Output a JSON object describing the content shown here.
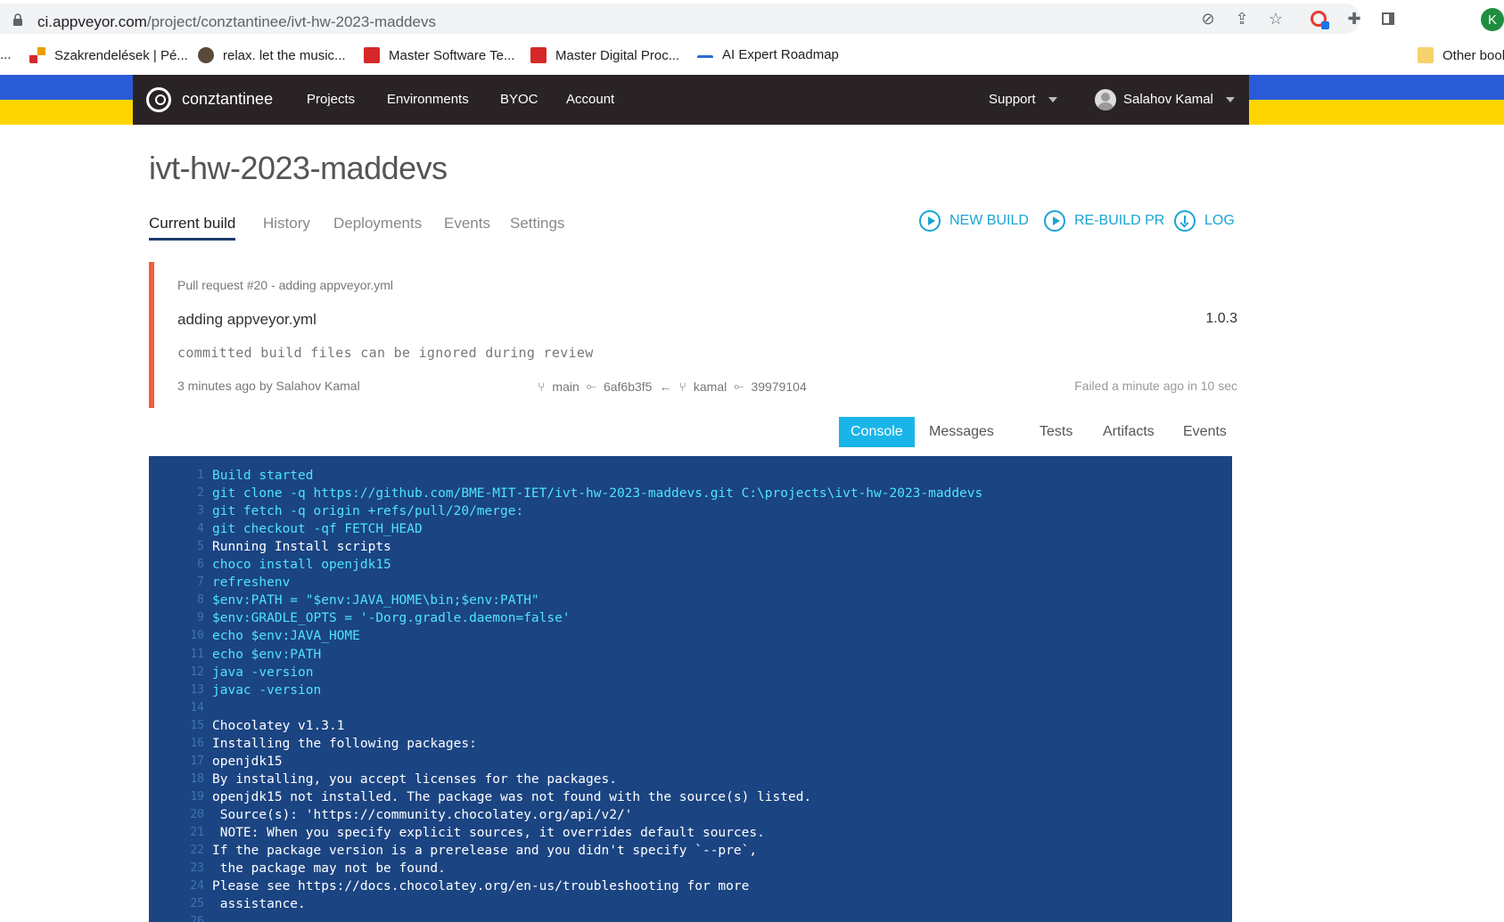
{
  "browser": {
    "url_host": "ci.appveyor.com",
    "url_path": "/project/conztantinee/ivt-hw-2023-maddevs",
    "profile_initial": "K",
    "bookmarks": [
      {
        "label": "...",
        "color": ""
      },
      {
        "label": "Szakrendelések | Pé...",
        "color": "#e8a000"
      },
      {
        "label": "relax. let the music...",
        "color": "#5a4a3a"
      },
      {
        "label": "Master Software Te...",
        "color": "#d62828"
      },
      {
        "label": "Master Digital Proc...",
        "color": "#d62828"
      },
      {
        "label": "AI Expert Roadmap",
        "color": "#2a6ad6"
      }
    ],
    "other_bookmarks": "Other book"
  },
  "nav": {
    "brand": "conztantinee",
    "links": [
      "Projects",
      "Environments",
      "BYOC",
      "Account"
    ],
    "support": "Support",
    "user": "Salahov Kamal"
  },
  "project": {
    "title": "ivt-hw-2023-maddevs",
    "tabs": [
      "Current build",
      "History",
      "Deployments",
      "Events",
      "Settings"
    ],
    "actions": [
      "NEW BUILD",
      "RE-BUILD PR",
      "LOG"
    ]
  },
  "build": {
    "pull_request": "Pull request #20 - adding appveyor.yml",
    "message": "adding appveyor.yml",
    "version": "1.0.3",
    "description": "committed build files can be ignored during review",
    "author": "3 minutes ago by Salahov Kamal",
    "base_branch": "main",
    "base_commit": "6af6b3f5",
    "head_branch": "kamal",
    "head_commit": "39979104",
    "status": "Failed a minute ago in 10 sec"
  },
  "console_tabs": [
    "Console",
    "Messages",
    "Tests",
    "Artifacts",
    "Events"
  ],
  "console": [
    {
      "n": "1",
      "text": "Build started",
      "kind": "cmd"
    },
    {
      "n": "2",
      "text": "git clone -q https://github.com/BME-MIT-IET/ivt-hw-2023-maddevs.git C:\\projects\\ivt-hw-2023-maddevs",
      "kind": "cmd"
    },
    {
      "n": "3",
      "text": "git fetch -q origin +refs/pull/20/merge:",
      "kind": "cmd"
    },
    {
      "n": "4",
      "text": "git checkout -qf FETCH_HEAD",
      "kind": "cmd"
    },
    {
      "n": "5",
      "text": "Running Install scripts",
      "kind": "out"
    },
    {
      "n": "6",
      "text": "choco install openjdk15",
      "kind": "cmd"
    },
    {
      "n": "7",
      "text": "refreshenv",
      "kind": "cmd"
    },
    {
      "n": "8",
      "text": "$env:PATH = \"$env:JAVA_HOME\\bin;$env:PATH\"",
      "kind": "cmd"
    },
    {
      "n": "9",
      "text": "$env:GRADLE_OPTS = '-Dorg.gradle.daemon=false'",
      "kind": "cmd"
    },
    {
      "n": "10",
      "text": "echo $env:JAVA_HOME",
      "kind": "cmd"
    },
    {
      "n": "11",
      "text": "echo $env:PATH",
      "kind": "cmd"
    },
    {
      "n": "12",
      "text": "java -version",
      "kind": "cmd"
    },
    {
      "n": "13",
      "text": "javac -version",
      "kind": "cmd"
    },
    {
      "n": "14",
      "text": "",
      "kind": "out"
    },
    {
      "n": "15",
      "text": "Chocolatey v1.3.1",
      "kind": "out"
    },
    {
      "n": "16",
      "text": "Installing the following packages:",
      "kind": "out"
    },
    {
      "n": "17",
      "text": "openjdk15",
      "kind": "out"
    },
    {
      "n": "18",
      "text": "By installing, you accept licenses for the packages.",
      "kind": "out"
    },
    {
      "n": "19",
      "text": "openjdk15 not installed. The package was not found with the source(s) listed.",
      "kind": "out"
    },
    {
      "n": "20",
      "text": " Source(s): 'https://community.chocolatey.org/api/v2/'",
      "kind": "out"
    },
    {
      "n": "21",
      "text": " NOTE: When you specify explicit sources, it overrides default sources.",
      "kind": "out"
    },
    {
      "n": "22",
      "text": "If the package version is a prerelease and you didn't specify `--pre`,",
      "kind": "out"
    },
    {
      "n": "23",
      "text": " the package may not be found.",
      "kind": "out"
    },
    {
      "n": "24",
      "text": "Please see https://docs.chocolatey.org/en-us/troubleshooting for more",
      "kind": "out"
    },
    {
      "n": "25",
      "text": " assistance.",
      "kind": "out"
    },
    {
      "n": "26",
      "text": "",
      "kind": "out"
    }
  ],
  "colors": {
    "accent": "#1aa4d6",
    "failed_bar": "#f25d3c",
    "console_bg": "#1b4482",
    "console_cmd": "#4fe3ff",
    "nav_bg": "#2a2326"
  }
}
